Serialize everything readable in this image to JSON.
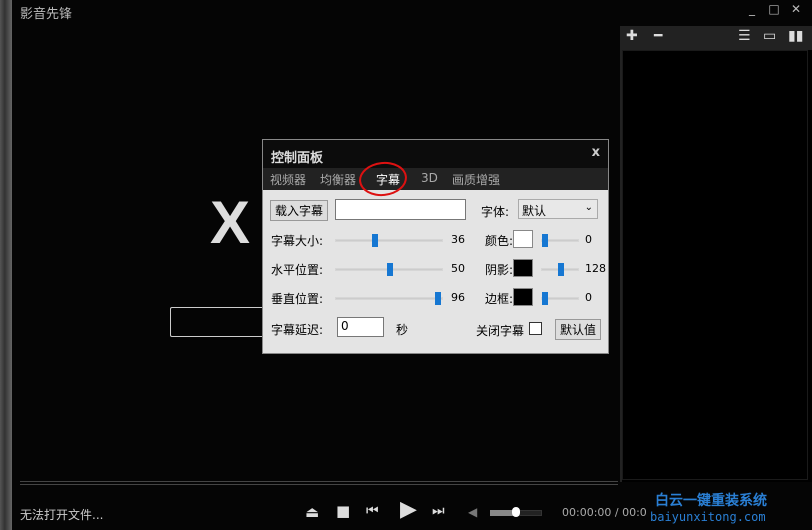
{
  "app": {
    "title": "影音先锋",
    "window_controls": [
      "minimize",
      "maximize",
      "close"
    ]
  },
  "playlist": {
    "toolbar": [
      "add-icon",
      "remove-icon",
      "list-icon",
      "chat-icon",
      "signal-icon"
    ]
  },
  "video": {
    "big_glyph": "X"
  },
  "bottom": {
    "status": "无法打开文件...",
    "time": "00:00:00 / 00:0",
    "volume_percent": 50,
    "watermark_cn": "白云一键重装系统",
    "watermark_url": "baiyunxitong.com"
  },
  "dialog": {
    "title": "控制面板",
    "close": "x",
    "tabs": [
      "视频器",
      "均衡器",
      "字幕",
      "3D",
      "画质增强"
    ],
    "active_tab": 2,
    "load_button": "载入字幕",
    "subtitle_path": "",
    "font_label": "字体:",
    "font_value": "默认",
    "sliders": [
      {
        "label": "字幕大小:",
        "value": "36",
        "percent": 36
      },
      {
        "label": "水平位置:",
        "value": "50",
        "percent": 50
      },
      {
        "label": "垂直位置:",
        "value": "96",
        "percent": 96
      }
    ],
    "colors": [
      {
        "label": "颜色:",
        "swatch": "#ffffff",
        "value": "0",
        "percent": 0
      },
      {
        "label": "阴影:",
        "swatch": "#000000",
        "value": "128",
        "percent": 50
      },
      {
        "label": "边框:",
        "swatch": "#000000",
        "value": "0",
        "percent": 0
      }
    ],
    "delay_label": "字幕延迟:",
    "delay_value": "0",
    "delay_unit": "秒",
    "close_sub_label": "关闭字幕",
    "close_sub_checked": false,
    "default_button": "默认值"
  }
}
